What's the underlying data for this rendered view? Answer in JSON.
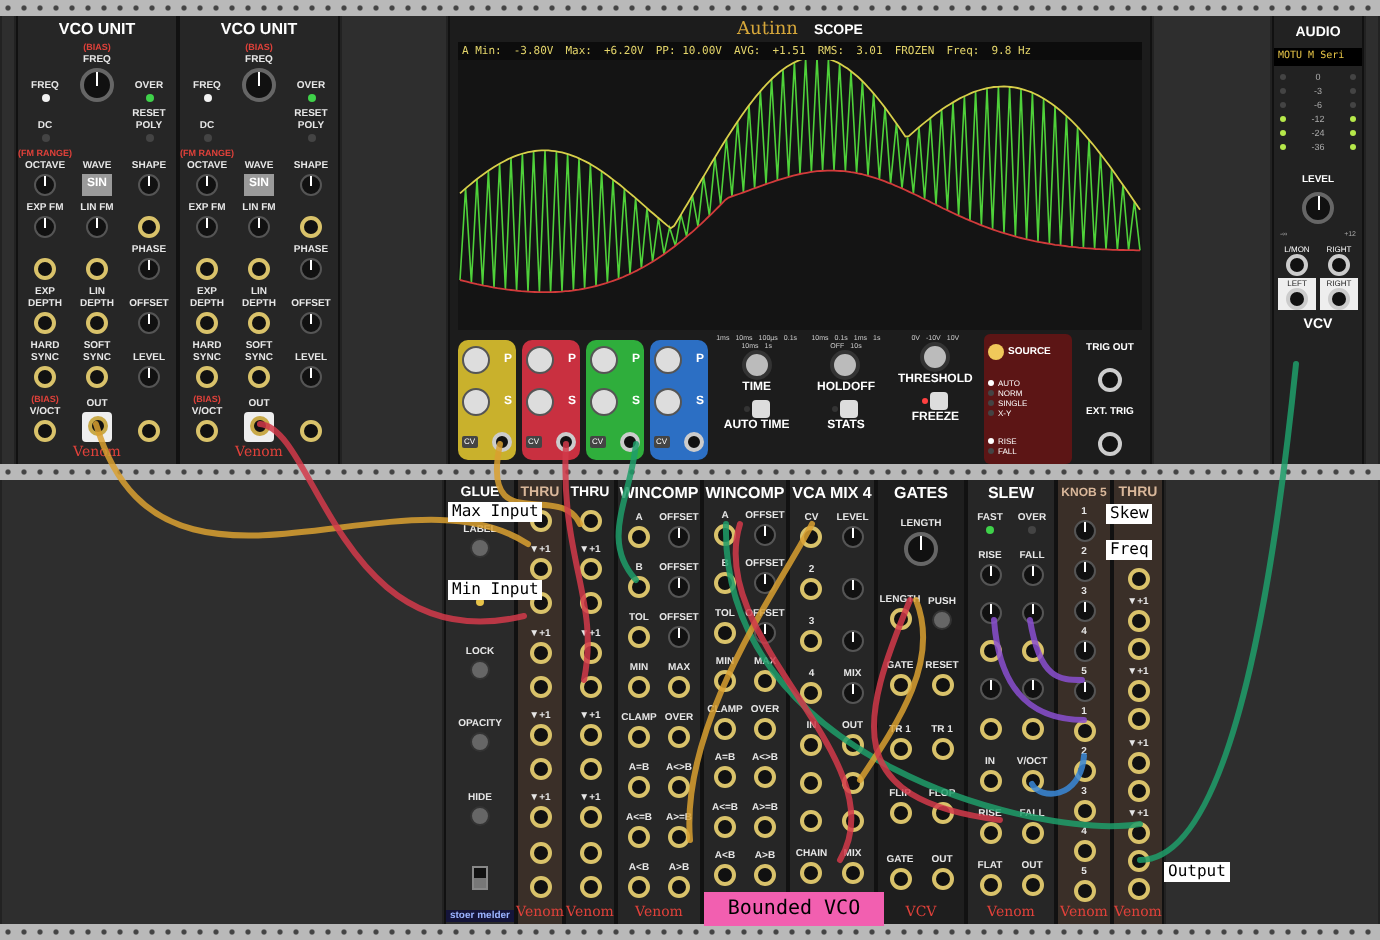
{
  "vco_units": [
    {
      "title": "VCO UNIT",
      "brand": "Venom",
      "controls": [
        {
          "kind": "led",
          "label": "FREQ",
          "on": true,
          "color": "#f2f2f2"
        },
        {
          "kind": "bigknob",
          "label": "FREQ",
          "sublabel": "(BIAS)"
        },
        {
          "kind": "led",
          "label": "OVER",
          "on": true,
          "color": "#3fd24a"
        },
        {
          "kind": "led",
          "label": "DC",
          "on": false
        },
        {
          "kind": "blank"
        },
        {
          "kind": "led",
          "label": "RESET POLY",
          "on": false
        },
        {
          "kind": "knob",
          "label": "OCTAVE",
          "sublabel": "(FM RANGE)"
        },
        {
          "kind": "button",
          "label": "WAVE",
          "text": "SIN"
        },
        {
          "kind": "knob",
          "label": "SHAPE"
        },
        {
          "kind": "knob",
          "label": "EXP FM"
        },
        {
          "kind": "knob",
          "label": "LIN FM"
        },
        {
          "kind": "jack"
        },
        {
          "kind": "jack"
        },
        {
          "kind": "jack"
        },
        {
          "kind": "knob",
          "label": "PHASE"
        },
        {
          "kind": "jack",
          "label": "EXP DEPTH"
        },
        {
          "kind": "jack",
          "label": "LIN DEPTH"
        },
        {
          "kind": "knob",
          "label": "OFFSET"
        },
        {
          "kind": "jack",
          "label": "HARD SYNC"
        },
        {
          "kind": "jack",
          "label": "SOFT SYNC"
        },
        {
          "kind": "knob",
          "label": "LEVEL"
        },
        {
          "kind": "jack",
          "label": "V/OCT",
          "sublabel": "(BIAS)"
        },
        {
          "kind": "outjack",
          "label": "OUT"
        },
        {
          "kind": "jack"
        }
      ]
    },
    {
      "title": "VCO UNIT",
      "brand": "Venom",
      "controls": [
        {
          "kind": "led",
          "label": "FREQ",
          "on": true,
          "color": "#f2f2f2"
        },
        {
          "kind": "bigknob",
          "label": "FREQ",
          "sublabel": "(BIAS)"
        },
        {
          "kind": "led",
          "label": "OVER",
          "on": true,
          "color": "#3fd24a"
        },
        {
          "kind": "led",
          "label": "DC",
          "on": false
        },
        {
          "kind": "blank"
        },
        {
          "kind": "led",
          "label": "RESET POLY",
          "on": false
        },
        {
          "kind": "knob",
          "label": "OCTAVE",
          "sublabel": "(FM RANGE)"
        },
        {
          "kind": "button",
          "label": "WAVE",
          "text": "SIN"
        },
        {
          "kind": "knob",
          "label": "SHAPE"
        },
        {
          "kind": "knob",
          "label": "EXP FM"
        },
        {
          "kind": "knob",
          "label": "LIN FM"
        },
        {
          "kind": "jack"
        },
        {
          "kind": "jack"
        },
        {
          "kind": "jack"
        },
        {
          "kind": "knob",
          "label": "PHASE"
        },
        {
          "kind": "jack",
          "label": "EXP DEPTH"
        },
        {
          "kind": "jack",
          "label": "LIN DEPTH"
        },
        {
          "kind": "knob",
          "label": "OFFSET"
        },
        {
          "kind": "jack",
          "label": "HARD SYNC"
        },
        {
          "kind": "jack",
          "label": "SOFT SYNC"
        },
        {
          "kind": "knob",
          "label": "LEVEL"
        },
        {
          "kind": "jack",
          "label": "V/OCT",
          "sublabel": "(BIAS)"
        },
        {
          "kind": "outjack",
          "label": "OUT"
        },
        {
          "kind": "jack"
        }
      ]
    }
  ],
  "scope": {
    "brand": "Autinn",
    "title": "SCOPE",
    "stats": [
      "A Min:",
      "-3.80V",
      "Max:",
      "+6.20V",
      "PP: 10.00V",
      "AVG:",
      "+1.51",
      "RMS:",
      "3.01",
      "FROZEN",
      "Freq:",
      "9.8 Hz"
    ],
    "channels": [
      {
        "color": "#c9b12c",
        "p": "P",
        "s": "S",
        "cv": "CV"
      },
      {
        "color": "#c93040",
        "p": "P",
        "s": "S",
        "cv": "CV"
      },
      {
        "color": "#2fae3c",
        "p": "P",
        "s": "S",
        "cv": "CV"
      },
      {
        "color": "#2c6fc4",
        "p": "P",
        "s": "S",
        "cv": "CV"
      }
    ],
    "knobs": [
      {
        "label": "TIME",
        "ticks": [
          "1ms",
          "10ms",
          "100µs",
          "0.1s",
          "10ms",
          "1s"
        ]
      },
      {
        "label": "HOLDOFF",
        "ticks": [
          "10ms",
          "0.1s",
          "1ms",
          "1s",
          "OFF",
          "10s"
        ]
      },
      {
        "label": "THRESHOLD",
        "ticks": [
          "0V",
          "-10V",
          "10V"
        ]
      }
    ],
    "buttons": [
      {
        "label": "AUTO TIME",
        "on": false
      },
      {
        "label": "STATS",
        "on": false
      },
      {
        "label": "FREEZE",
        "on": true
      }
    ],
    "source": {
      "label": "SOURCE",
      "on": true
    },
    "modes": [
      {
        "label": "AUTO",
        "selected": true
      },
      {
        "label": "NORM",
        "selected": false
      },
      {
        "label": "SINGLE",
        "selected": false
      },
      {
        "label": "X-Y",
        "selected": false
      }
    ],
    "slopes": [
      {
        "label": "RISE",
        "selected": true
      },
      {
        "label": "FALL",
        "selected": false
      }
    ],
    "trig_out": "TRIG OUT",
    "ext_trig": "EXT. TRIG"
  },
  "audio": {
    "title": "AUDIO",
    "device": "MOTU M Seri",
    "meters": [
      {
        "label": "0",
        "lit": false
      },
      {
        "label": "-3",
        "lit": false
      },
      {
        "label": "-6",
        "lit": false
      },
      {
        "label": "-12",
        "lit": true
      },
      {
        "label": "-24",
        "lit": true
      },
      {
        "label": "-36",
        "lit": true
      }
    ],
    "level_label": "LEVEL",
    "level_min": "-∞",
    "level_max": "+12",
    "jacks": [
      "L/MON",
      "RIGHT",
      "LEFT",
      "RIGHT"
    ],
    "brand": "VCV"
  },
  "bottom_modules": [
    {
      "kind": "glue",
      "title": "GLUE",
      "brand": "stoer melder",
      "controls": [
        {
          "kind": "pushbutton",
          "label": "LABEL"
        },
        {
          "kind": "led",
          "on": true,
          "color": "#e8c44a"
        },
        {
          "kind": "pushbutton",
          "label": "LOCK"
        },
        {
          "kind": "pushbutton",
          "label": "OPACITY"
        },
        {
          "kind": "pushbutton",
          "label": "HIDE"
        },
        {
          "kind": "switch",
          "on": false
        }
      ]
    },
    {
      "kind": "thru_light",
      "title": "THRU",
      "brand": "Venom",
      "controls": [
        {
          "kind": "jack"
        },
        {
          "kind": "jack",
          "label": "▼+1"
        },
        {
          "kind": "jack"
        },
        {
          "kind": "jack",
          "label": "▼+1"
        },
        {
          "kind": "jack"
        },
        {
          "kind": "jack",
          "label": "▼+1"
        },
        {
          "kind": "jack"
        },
        {
          "kind": "jack",
          "label": "▼+1"
        },
        {
          "kind": "jack"
        },
        {
          "kind": "jack"
        }
      ]
    },
    {
      "kind": "thru",
      "title": "THRU",
      "brand": "Venom",
      "controls": [
        {
          "kind": "jack"
        },
        {
          "kind": "jack",
          "label": "▼+1"
        },
        {
          "kind": "jack"
        },
        {
          "kind": "jack",
          "label": "▼+1"
        },
        {
          "kind": "jack"
        },
        {
          "kind": "jack",
          "label": "▼+1"
        },
        {
          "kind": "jack"
        },
        {
          "kind": "jack",
          "label": "▼+1"
        },
        {
          "kind": "jack"
        },
        {
          "kind": "jack"
        }
      ]
    },
    {
      "kind": "wincomp",
      "title": "WINCOMP",
      "brand": "Venom",
      "controls": [
        {
          "kind": "jack",
          "label": "A"
        },
        {
          "kind": "knob",
          "label": "OFFSET"
        },
        {
          "kind": "jack",
          "label": "B"
        },
        {
          "kind": "knob",
          "label": "OFFSET"
        },
        {
          "kind": "jack",
          "label": "TOL"
        },
        {
          "kind": "knob",
          "label": "OFFSET"
        },
        {
          "kind": "jack",
          "label": "MIN"
        },
        {
          "kind": "jack",
          "label": "MAX"
        },
        {
          "kind": "jack",
          "label": "CLAMP"
        },
        {
          "kind": "jack",
          "label": "OVER"
        },
        {
          "kind": "jack",
          "label": "A=B"
        },
        {
          "kind": "jack",
          "label": "A<>B"
        },
        {
          "kind": "jack",
          "label": "A<=B"
        },
        {
          "kind": "jack",
          "label": "A>=B"
        },
        {
          "kind": "jack",
          "label": "A<B"
        },
        {
          "kind": "jack",
          "label": "A>B"
        }
      ]
    },
    {
      "kind": "wincomp",
      "title": "WINCOMP",
      "controls": [
        {
          "kind": "jack",
          "label": "A"
        },
        {
          "kind": "knob",
          "label": "OFFSET"
        },
        {
          "kind": "jack",
          "label": "B"
        },
        {
          "kind": "knob",
          "label": "OFFSET"
        },
        {
          "kind": "jack",
          "label": "TOL"
        },
        {
          "kind": "knob",
          "label": "OFFSET"
        },
        {
          "kind": "jack",
          "label": "MIN"
        },
        {
          "kind": "jack",
          "label": "MAX"
        },
        {
          "kind": "jack",
          "label": "CLAMP"
        },
        {
          "kind": "jack",
          "label": "OVER"
        },
        {
          "kind": "jack",
          "label": "A=B"
        },
        {
          "kind": "jack",
          "label": "A<>B"
        },
        {
          "kind": "jack",
          "label": "A<=B"
        },
        {
          "kind": "jack",
          "label": "A>=B"
        },
        {
          "kind": "jack",
          "label": "A<B"
        },
        {
          "kind": "jack",
          "label": "A>B"
        }
      ]
    },
    {
      "kind": "vcamix",
      "title": "VCA MIX 4",
      "controls": [
        {
          "kind": "jack",
          "label": "CV"
        },
        {
          "kind": "knob",
          "label": "LEVEL"
        },
        {
          "kind": "jack",
          "label": "2"
        },
        {
          "kind": "knob"
        },
        {
          "kind": "jack",
          "label": "3"
        },
        {
          "kind": "knob"
        },
        {
          "kind": "jack",
          "label": "4"
        },
        {
          "kind": "knob",
          "label": "MIX"
        },
        {
          "kind": "jack",
          "label": "IN"
        },
        {
          "kind": "jack",
          "label": "OUT"
        },
        {
          "kind": "jack"
        },
        {
          "kind": "jack"
        },
        {
          "kind": "jack"
        },
        {
          "kind": "jack"
        },
        {
          "kind": "jack",
          "label": "CHAIN"
        },
        {
          "kind": "jack",
          "label": "MIX"
        }
      ]
    },
    {
      "kind": "gates",
      "title": "GATES",
      "brand": "VCV",
      "controls": [
        {
          "kind": "wideknob",
          "label": "LENGTH"
        },
        {
          "kind": "jack",
          "label": "LENGTH"
        },
        {
          "kind": "pushbutton",
          "label": "PUSH"
        },
        {
          "kind": "jack",
          "label": "GATE"
        },
        {
          "kind": "jack",
          "label": "RESET"
        },
        {
          "kind": "jack",
          "label": "TR 1"
        },
        {
          "kind": "jack",
          "label": "TR 1"
        },
        {
          "kind": "jack",
          "label": "FLIP"
        },
        {
          "kind": "jack",
          "label": "FLOP"
        },
        {
          "kind": "jack",
          "label": "GATE"
        },
        {
          "kind": "jack",
          "label": "OUT"
        }
      ]
    },
    {
      "kind": "slew",
      "title": "SLEW",
      "brand": "Venom",
      "controls": [
        {
          "kind": "led",
          "label": "FAST",
          "on": true,
          "color": "#3fd24a"
        },
        {
          "kind": "led",
          "label": "OVER",
          "on": false
        },
        {
          "kind": "knob",
          "label": "RISE"
        },
        {
          "kind": "knob",
          "label": "FALL"
        },
        {
          "kind": "knob"
        },
        {
          "kind": "knob"
        },
        {
          "kind": "jack"
        },
        {
          "kind": "jack"
        },
        {
          "kind": "knob"
        },
        {
          "kind": "knob"
        },
        {
          "kind": "jack"
        },
        {
          "kind": "jack"
        },
        {
          "kind": "jack",
          "label": "IN"
        },
        {
          "kind": "jack",
          "label": "V/OCT"
        },
        {
          "kind": "jack",
          "label": "RISE"
        },
        {
          "kind": "jack",
          "label": "FALL"
        },
        {
          "kind": "jack",
          "label": "FLAT"
        },
        {
          "kind": "jack",
          "label": "OUT"
        }
      ]
    },
    {
      "kind": "knob5",
      "title": "KNOB 5",
      "brand": "Venom",
      "controls": [
        {
          "kind": "knob",
          "label": "1"
        },
        {
          "kind": "knob",
          "label": "2"
        },
        {
          "kind": "knob",
          "label": "3"
        },
        {
          "kind": "knob",
          "label": "4"
        },
        {
          "kind": "knob",
          "label": "5"
        },
        {
          "kind": "jack",
          "label": "1"
        },
        {
          "kind": "jack",
          "label": "2"
        },
        {
          "kind": "jack",
          "label": "3"
        },
        {
          "kind": "jack",
          "label": "4"
        },
        {
          "kind": "jack",
          "label": "5"
        }
      ]
    },
    {
      "kind": "thru_light",
      "title": "THRU",
      "brand": "Venom",
      "controls": [
        {
          "kind": "jack"
        },
        {
          "kind": "jack",
          "label": "▼+1"
        },
        {
          "kind": "jack"
        },
        {
          "kind": "jack",
          "label": "▼+1"
        },
        {
          "kind": "jack"
        },
        {
          "kind": "jack",
          "label": "▼+1"
        },
        {
          "kind": "jack"
        },
        {
          "kind": "jack",
          "label": "▼+1"
        },
        {
          "kind": "jack"
        },
        {
          "kind": "jack"
        }
      ]
    }
  ],
  "notes": [
    {
      "kind": "label",
      "text": "Max Input"
    },
    {
      "kind": "label",
      "text": "Min Input"
    },
    {
      "kind": "label",
      "text": "Skew"
    },
    {
      "kind": "label",
      "text": "Freq"
    },
    {
      "kind": "label",
      "text": "Output"
    },
    {
      "kind": "banner",
      "text": "Bounded VCO"
    }
  ]
}
